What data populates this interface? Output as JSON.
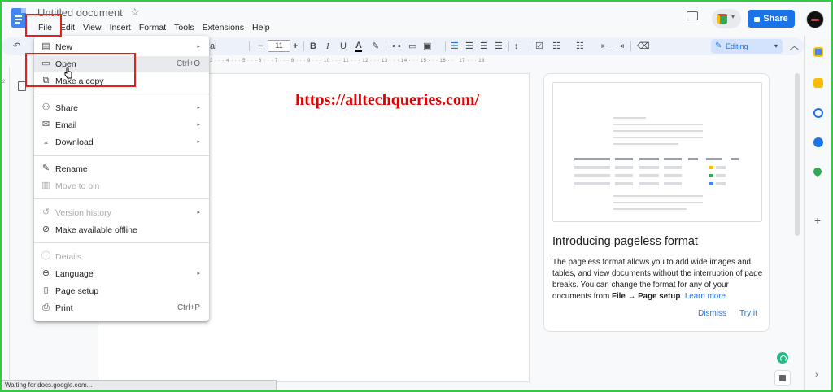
{
  "header": {
    "doc_title": "Untitled document",
    "menu": [
      "File",
      "Edit",
      "View",
      "Insert",
      "Format",
      "Tools",
      "Extensions",
      "Help"
    ],
    "share_label": "Share"
  },
  "toolbar": {
    "font_tail": "al",
    "font_size": "11",
    "mode_label": "Editing",
    "ruler_text": "3 · · · 4 · · · 5 · · · 6 · · · 7 · · · 8 · · · 9 · · · 10 · · · 11 · · · 12 · · · 13 · · · 14 · · · 15 · · · 16 · · · 17 · · · 18",
    "vruler_mark": "2"
  },
  "file_menu": {
    "items": [
      {
        "label": "New",
        "icon": "new-doc-icon",
        "glyph": "▤",
        "shortcut": "",
        "submenu": true,
        "disabled": false
      },
      {
        "label": "Open",
        "icon": "folder-icon",
        "glyph": "▭",
        "shortcut": "Ctrl+O",
        "submenu": false,
        "disabled": false
      },
      {
        "label": "Make a copy",
        "icon": "copy-icon",
        "glyph": "⧉",
        "shortcut": "",
        "submenu": false,
        "disabled": false
      },
      {
        "label": "Share",
        "icon": "share-person-icon",
        "glyph": "⚇",
        "shortcut": "",
        "submenu": true,
        "disabled": false
      },
      {
        "label": "Email",
        "icon": "email-icon",
        "glyph": "✉",
        "shortcut": "",
        "submenu": true,
        "disabled": false
      },
      {
        "label": "Download",
        "icon": "download-icon",
        "glyph": "⤓",
        "shortcut": "",
        "submenu": true,
        "disabled": false
      },
      {
        "label": "Rename",
        "icon": "rename-icon",
        "glyph": "✎",
        "shortcut": "",
        "submenu": false,
        "disabled": false
      },
      {
        "label": "Move to bin",
        "icon": "trash-icon",
        "glyph": "🗑",
        "shortcut": "",
        "submenu": false,
        "disabled": true
      },
      {
        "label": "Version history",
        "icon": "history-icon",
        "glyph": "↺",
        "shortcut": "",
        "submenu": true,
        "disabled": true
      },
      {
        "label": "Make available offline",
        "icon": "offline-icon",
        "glyph": "⊘",
        "shortcut": "",
        "submenu": false,
        "disabled": false
      },
      {
        "label": "Details",
        "icon": "info-icon",
        "glyph": "ⓘ",
        "shortcut": "",
        "submenu": false,
        "disabled": true
      },
      {
        "label": "Language",
        "icon": "globe-icon",
        "glyph": "⊕",
        "shortcut": "",
        "submenu": true,
        "disabled": false
      },
      {
        "label": "Page setup",
        "icon": "page-setup-icon",
        "glyph": "▯",
        "shortcut": "",
        "submenu": false,
        "disabled": false
      },
      {
        "label": "Print",
        "icon": "print-icon",
        "glyph": "⎙",
        "shortcut": "Ctrl+P",
        "submenu": false,
        "disabled": false
      }
    ]
  },
  "watermark": "https://alltechqueries.com/",
  "side_panel": {
    "title": "Introducing pageless format",
    "body_start": "The pageless format allows you to add wide images and tables, and view documents without the interruption of page breaks. You can change the format for any of your documents from ",
    "body_bold": "File → Page setup",
    "body_end": ". ",
    "learn_more": "Learn more",
    "dismiss": "Dismiss",
    "try_it": "Try it"
  },
  "status_text": "Waiting for docs.google.com...",
  "colors": {
    "accent": "#1a73e8",
    "highlight_box": "#e32020",
    "frame": "#2ecc40",
    "watermark": "#e10000"
  }
}
